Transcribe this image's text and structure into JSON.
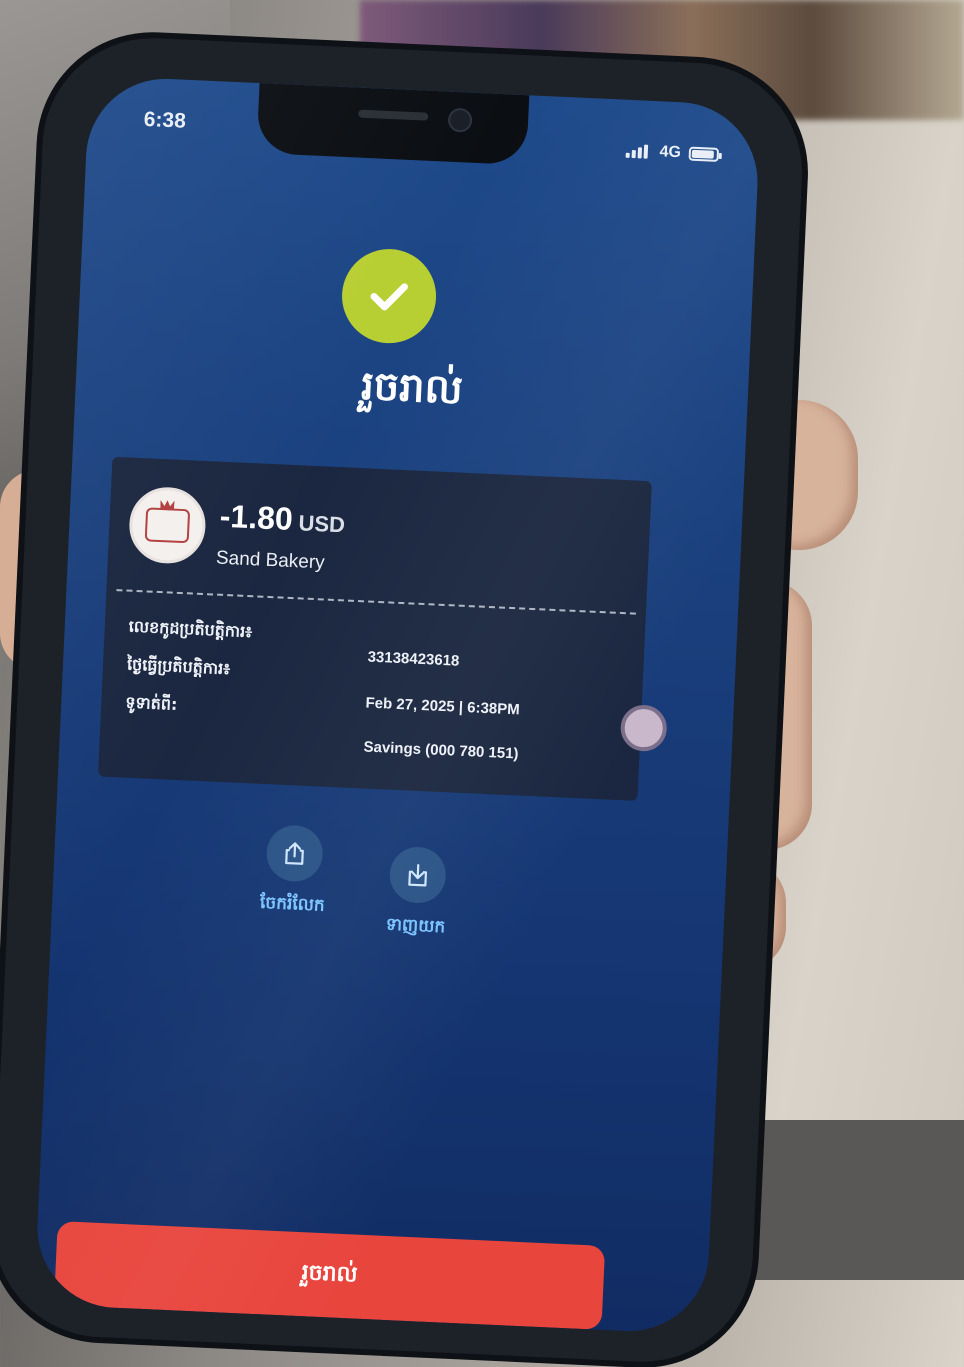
{
  "status_bar": {
    "time": "6:38",
    "network": "4G"
  },
  "result": {
    "title": "រួចរាល់"
  },
  "transaction": {
    "amount": "-1.80",
    "currency": "USD",
    "merchant": "Sand Bakery",
    "rows": [
      {
        "label": "លេខកូដប្រតិបត្តិការ៖",
        "value": "33138423618"
      },
      {
        "label": "ថ្ងៃធ្វើប្រតិបត្តិការ៖",
        "value": "Feb 27, 2025 | 6:38PM"
      },
      {
        "label": "ទូទាត់ពី:",
        "value": "Savings (000 780 151)"
      }
    ]
  },
  "actions": {
    "share": {
      "label": "ចែករំលែក",
      "icon": "share-icon"
    },
    "download": {
      "label": "ទាញយក",
      "icon": "download-icon"
    }
  },
  "primary_button": {
    "label": "រួចរាល់"
  },
  "colors": {
    "success": "#b8cf33",
    "screen_bg": "#1a3f7c",
    "button": "#e8453d",
    "action_label": "#7bc3ff"
  }
}
